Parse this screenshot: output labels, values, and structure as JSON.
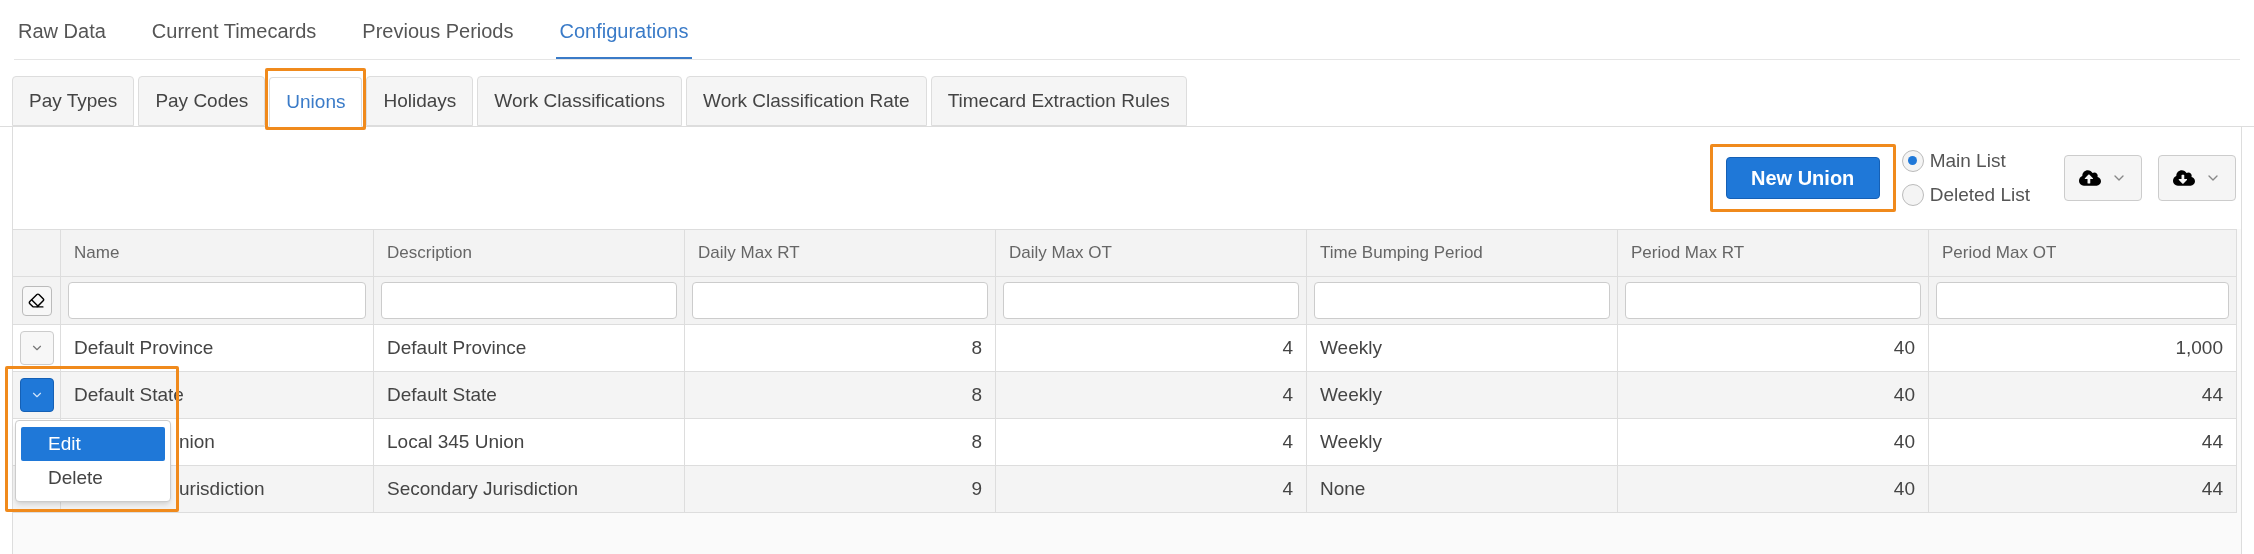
{
  "top_tabs": [
    {
      "label": "Raw Data",
      "selected": false
    },
    {
      "label": "Current Timecards",
      "selected": false
    },
    {
      "label": "Previous Periods",
      "selected": false
    },
    {
      "label": "Configurations",
      "selected": true
    }
  ],
  "config_tabs": [
    {
      "label": "Pay Types",
      "selected": false,
      "highlighted": false
    },
    {
      "label": "Pay Codes",
      "selected": false,
      "highlighted": false
    },
    {
      "label": "Unions",
      "selected": true,
      "highlighted": true
    },
    {
      "label": "Holidays",
      "selected": false,
      "highlighted": false
    },
    {
      "label": "Work Classifications",
      "selected": false,
      "highlighted": false
    },
    {
      "label": "Work Classification Rate",
      "selected": false,
      "highlighted": false
    },
    {
      "label": "Timecard Extraction Rules",
      "selected": false,
      "highlighted": false
    }
  ],
  "toolbar": {
    "new_button": {
      "label": "New Union",
      "highlighted": true
    },
    "list_options": [
      {
        "label": "Main List",
        "selected": true
      },
      {
        "label": "Deleted List",
        "selected": false
      }
    ]
  },
  "table": {
    "columns": [
      {
        "label": "Name"
      },
      {
        "label": "Description"
      },
      {
        "label": "Daily Max RT"
      },
      {
        "label": "Daily Max OT"
      },
      {
        "label": "Time Bumping Period"
      },
      {
        "label": "Period Max RT"
      },
      {
        "label": "Period Max OT"
      }
    ],
    "rows": [
      {
        "menu_open": false,
        "cells": [
          "Default Province",
          "Default Province",
          "8",
          "4",
          "Weekly",
          "40",
          "1,000"
        ]
      },
      {
        "menu_open": true,
        "cells": [
          "Default State",
          "Default State",
          "8",
          "4",
          "Weekly",
          "40",
          "44"
        ]
      },
      {
        "menu_open": false,
        "cells": [
          "nion",
          "Local 345 Union",
          "8",
          "4",
          "Weekly",
          "40",
          "44"
        ]
      },
      {
        "menu_open": false,
        "cells": [
          "urisdiction",
          "Secondary Jurisdiction",
          "9",
          "4",
          "None",
          "40",
          "44"
        ]
      }
    ]
  },
  "row_menu": {
    "highlighted": true,
    "items": [
      {
        "label": "Edit",
        "selected": true
      },
      {
        "label": "Delete",
        "selected": false
      }
    ]
  }
}
